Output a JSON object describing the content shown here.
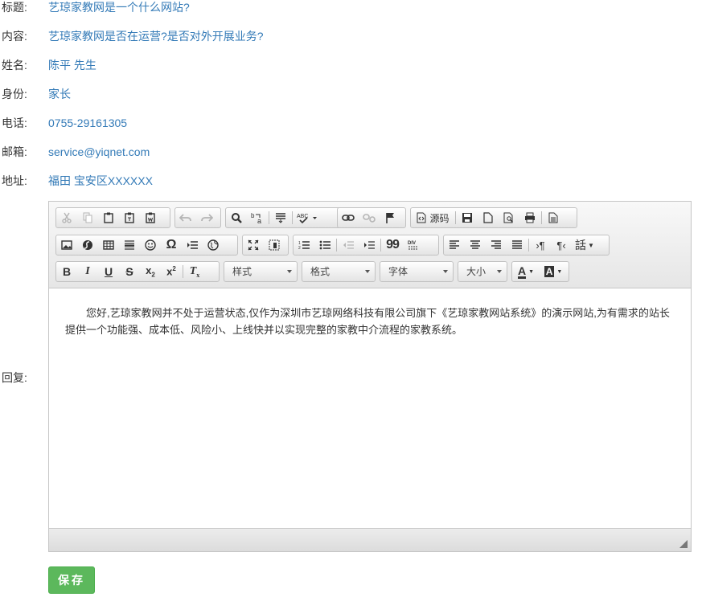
{
  "fields": [
    {
      "label": "标题:",
      "value": "艺琼家教网是一个什么网站?"
    },
    {
      "label": "内容:",
      "value": "艺琼家教网是否在运营?是否对外开展业务?"
    },
    {
      "label": "姓名:",
      "value": "陈平 先生"
    },
    {
      "label": "身份:",
      "value": "家长"
    },
    {
      "label": "电话:",
      "value": "0755-29161305"
    },
    {
      "label": "邮箱:",
      "value": "service@yiqnet.com"
    },
    {
      "label": "地址:",
      "value": "福田 宝安区XXXXXX"
    }
  ],
  "reply": {
    "label": "回复:",
    "text": "您好,艺琼家教网并不处于运营状态,仅作为深圳市艺琼网络科技有限公司旗下《艺琼家教网站系统》的演示网站,为有需求的站长提供一个功能强、成本低、风险小、上线快并以实现完整的家教中介流程的家教系统。"
  },
  "toolbar": {
    "source_label": "源码",
    "style_combo": "样式",
    "format_combo": "格式",
    "font_combo": "字体",
    "size_combo": "大小",
    "bold": "B",
    "italic": "I",
    "underline": "U",
    "strike": "S",
    "blockquote": "99"
  },
  "save_label": "保存",
  "colors": {
    "link": "#337ab7",
    "save_button": "#5cb85c"
  }
}
